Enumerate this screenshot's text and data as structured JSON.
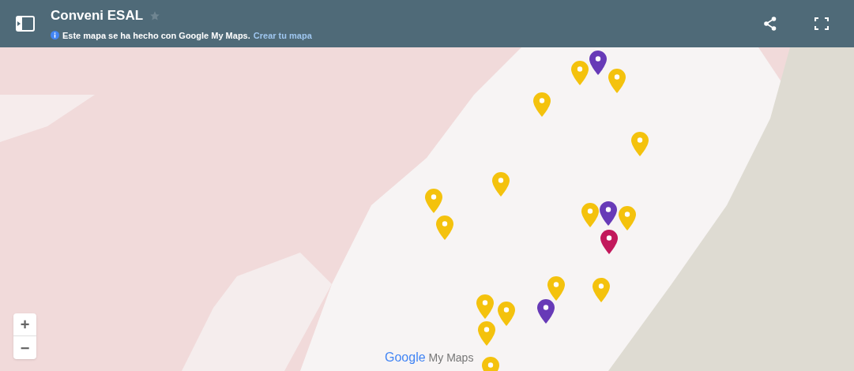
{
  "header": {
    "title": "Conveni ESAL",
    "starred": false,
    "info": "Este mapa se ha hecho con Google My Maps.",
    "link": "Crear tu mapa"
  },
  "map": {
    "zoom_in": "+",
    "zoom_out": "−",
    "logo_google": "Google",
    "logo_product": "My Maps",
    "pins": [
      {
        "color": "#f4c20d"
      },
      {
        "color": "#673ab7"
      },
      {
        "color": "#f4c20d"
      },
      {
        "color": "#f4c20d"
      },
      {
        "color": "#f4c20d"
      },
      {
        "color": "#f4c20d"
      },
      {
        "color": "#f4c20d"
      },
      {
        "color": "#f4c20d"
      },
      {
        "color": "#f4c20d"
      },
      {
        "color": "#f4c20d"
      },
      {
        "color": "#673ab7"
      },
      {
        "color": "#c2185b"
      },
      {
        "color": "#f4c20d"
      },
      {
        "color": "#f4c20d"
      },
      {
        "color": "#f4c20d"
      },
      {
        "color": "#f4c20d"
      },
      {
        "color": "#f4c20d"
      },
      {
        "color": "#673ab7"
      },
      {
        "color": "#f4c20d"
      }
    ]
  }
}
